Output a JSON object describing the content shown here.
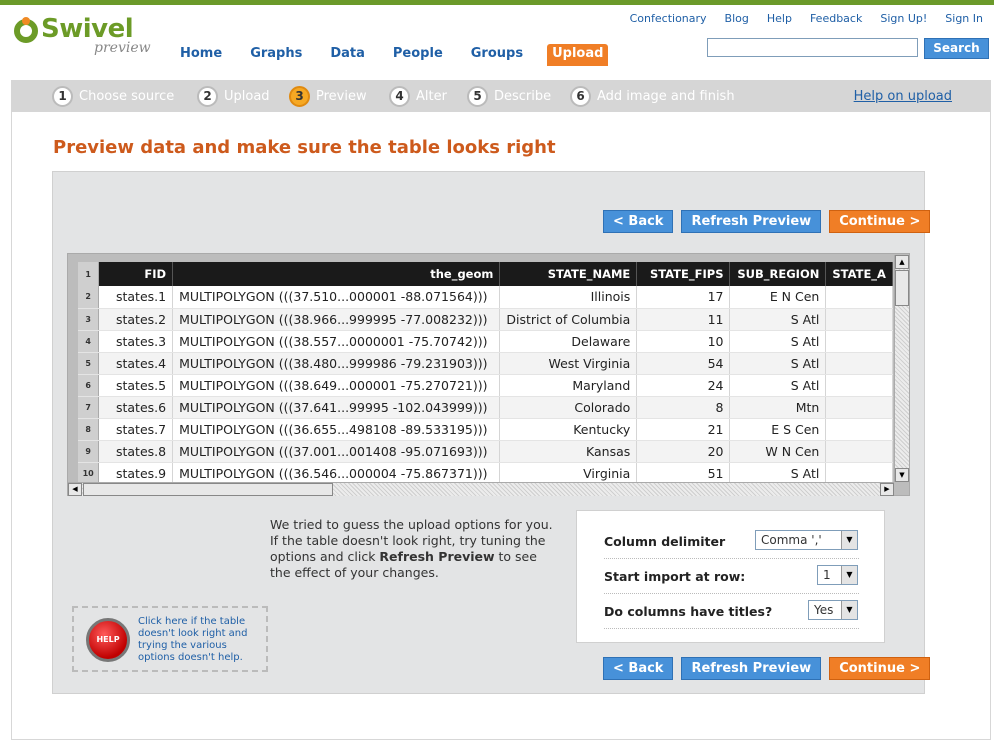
{
  "logo": {
    "name": "Swivel",
    "sub": "preview"
  },
  "util_links": [
    "Confectionary",
    "Blog",
    "Help",
    "Feedback",
    "Sign Up!",
    "Sign In"
  ],
  "main_nav": [
    "Home",
    "Graphs",
    "Data",
    "People",
    "Groups",
    "Upload"
  ],
  "main_nav_active": "Upload",
  "search": {
    "value": "",
    "button": "Search"
  },
  "steps": [
    {
      "num": "1",
      "label": "Choose source"
    },
    {
      "num": "2",
      "label": "Upload"
    },
    {
      "num": "3",
      "label": "Preview",
      "current": true
    },
    {
      "num": "4",
      "label": "Alter"
    },
    {
      "num": "5",
      "label": "Describe"
    },
    {
      "num": "6",
      "label": "Add image and finish"
    }
  ],
  "help_upload": "Help on upload",
  "page_title": "Preview data and make sure the table looks right",
  "buttons": {
    "back": "< Back",
    "refresh": "Refresh Preview",
    "continue": "Continue >"
  },
  "table": {
    "header_row_num": "1",
    "columns": [
      "FID",
      "the_geom",
      "STATE_NAME",
      "STATE_FIPS",
      "SUB_REGION",
      "STATE_A"
    ],
    "rows": [
      {
        "n": "2",
        "cells": [
          "states.1",
          "MULTIPOLYGON (((37.510...000001 -88.071564)))",
          "Illinois",
          "17",
          "E N Cen",
          ""
        ]
      },
      {
        "n": "3",
        "cells": [
          "states.2",
          "MULTIPOLYGON (((38.966...999995 -77.008232)))",
          "District of Columbia",
          "11",
          "S Atl",
          ""
        ]
      },
      {
        "n": "4",
        "cells": [
          "states.3",
          "MULTIPOLYGON (((38.557...0000001 -75.70742)))",
          "Delaware",
          "10",
          "S Atl",
          ""
        ]
      },
      {
        "n": "5",
        "cells": [
          "states.4",
          "MULTIPOLYGON (((38.480...999986 -79.231903)))",
          "West Virginia",
          "54",
          "S Atl",
          ""
        ]
      },
      {
        "n": "6",
        "cells": [
          "states.5",
          "MULTIPOLYGON (((38.649...000001 -75.270721)))",
          "Maryland",
          "24",
          "S Atl",
          ""
        ]
      },
      {
        "n": "7",
        "cells": [
          "states.6",
          "MULTIPOLYGON (((37.641...99995 -102.043999)))",
          "Colorado",
          "8",
          "Mtn",
          ""
        ]
      },
      {
        "n": "8",
        "cells": [
          "states.7",
          "MULTIPOLYGON (((36.655...498108 -89.533195)))",
          "Kentucky",
          "21",
          "E S Cen",
          ""
        ]
      },
      {
        "n": "9",
        "cells": [
          "states.8",
          "MULTIPOLYGON (((37.001...001408 -95.071693)))",
          "Kansas",
          "20",
          "W N Cen",
          ""
        ]
      },
      {
        "n": "10",
        "cells": [
          "states.9",
          "MULTIPOLYGON (((36.546...000004 -75.867371)))",
          "Virginia",
          "51",
          "S Atl",
          ""
        ]
      }
    ]
  },
  "guess_text": {
    "part1": "We tried to guess the upload options for you. If the table doesn't look right, try tuning the options and click ",
    "bold": "Refresh Preview",
    "part2": " to see the effect of your changes."
  },
  "help_box": {
    "circle": "HELP",
    "text": "Click here if the table doesn't look right and trying the various options doesn't help."
  },
  "options": [
    {
      "label": "Column delimiter",
      "value": "Comma ','"
    },
    {
      "label": "Start import at row:",
      "value": "1"
    },
    {
      "label": "Do columns have titles?",
      "value": "Yes"
    }
  ]
}
